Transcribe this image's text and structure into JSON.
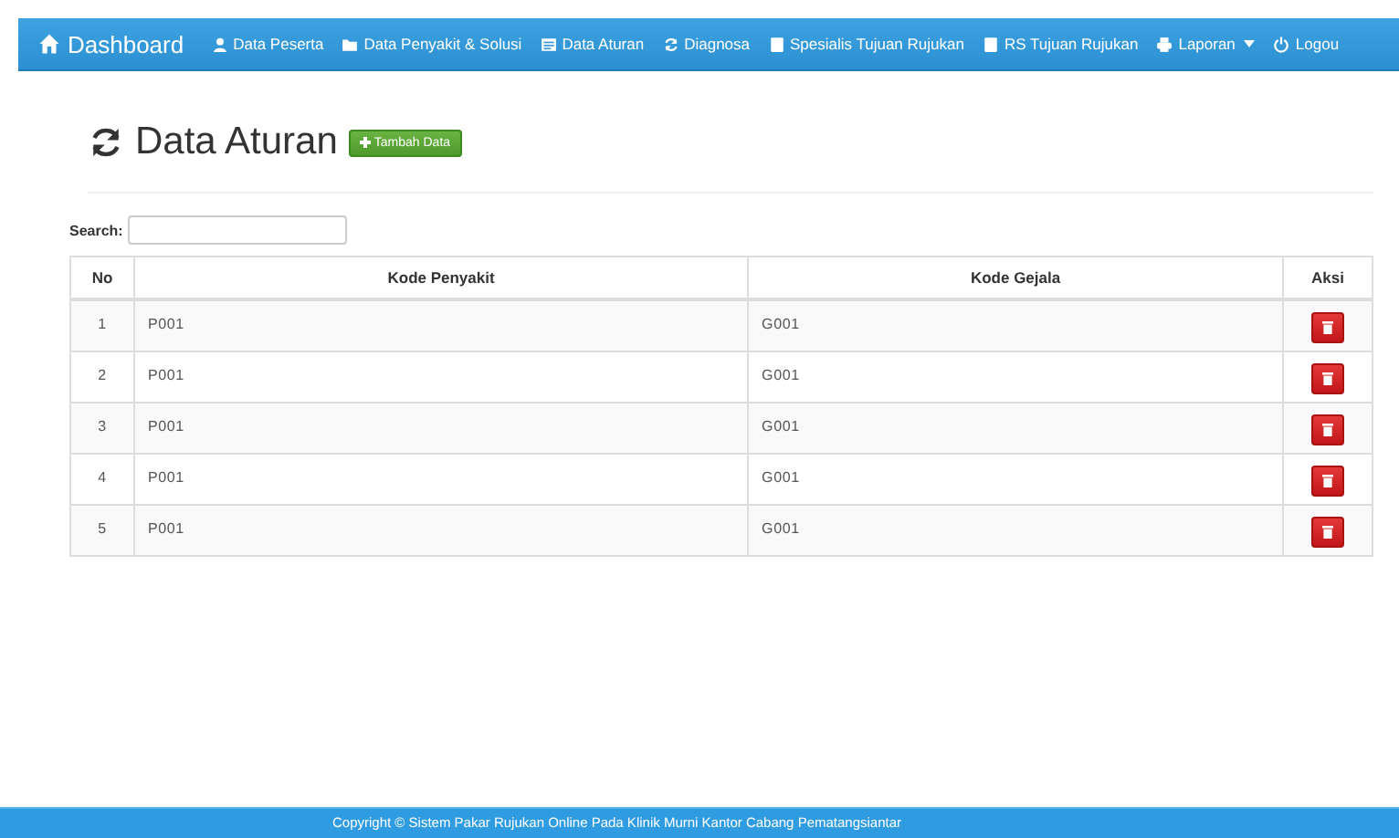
{
  "navbar": {
    "brand": {
      "label": "Dashboard"
    },
    "items": [
      {
        "label": "Data Peserta",
        "dropdown": false
      },
      {
        "label": "Data Penyakit & Solusi",
        "dropdown": false
      },
      {
        "label": "Data Aturan",
        "dropdown": false
      },
      {
        "label": "Diagnosa",
        "dropdown": false
      },
      {
        "label": "Spesialis Tujuan Rujukan",
        "dropdown": false
      },
      {
        "label": "RS Tujuan Rujukan",
        "dropdown": false
      },
      {
        "label": "Laporan",
        "dropdown": true
      },
      {
        "label": "Logou",
        "dropdown": false
      }
    ]
  },
  "heading": {
    "title": "Data Aturan",
    "add_button": "Tambah Data"
  },
  "search": {
    "label": "Search:"
  },
  "table": {
    "columns": [
      "No",
      "Kode Penyakit",
      "Kode Gejala",
      "Aksi"
    ],
    "rows": [
      {
        "no": "1",
        "kode_penyakit": "P001",
        "kode_gejala": "G001"
      },
      {
        "no": "2",
        "kode_penyakit": "P001",
        "kode_gejala": "G001"
      },
      {
        "no": "3",
        "kode_penyakit": "P001",
        "kode_gejala": "G001"
      },
      {
        "no": "4",
        "kode_penyakit": "P001",
        "kode_gejala": "G001"
      },
      {
        "no": "5",
        "kode_penyakit": "P001",
        "kode_gejala": "G001"
      }
    ]
  },
  "footer": {
    "text": "Copyright © Sistem Pakar Rujukan Online Pada Klinik Murni Kantor Cabang Pematangsiantar"
  }
}
